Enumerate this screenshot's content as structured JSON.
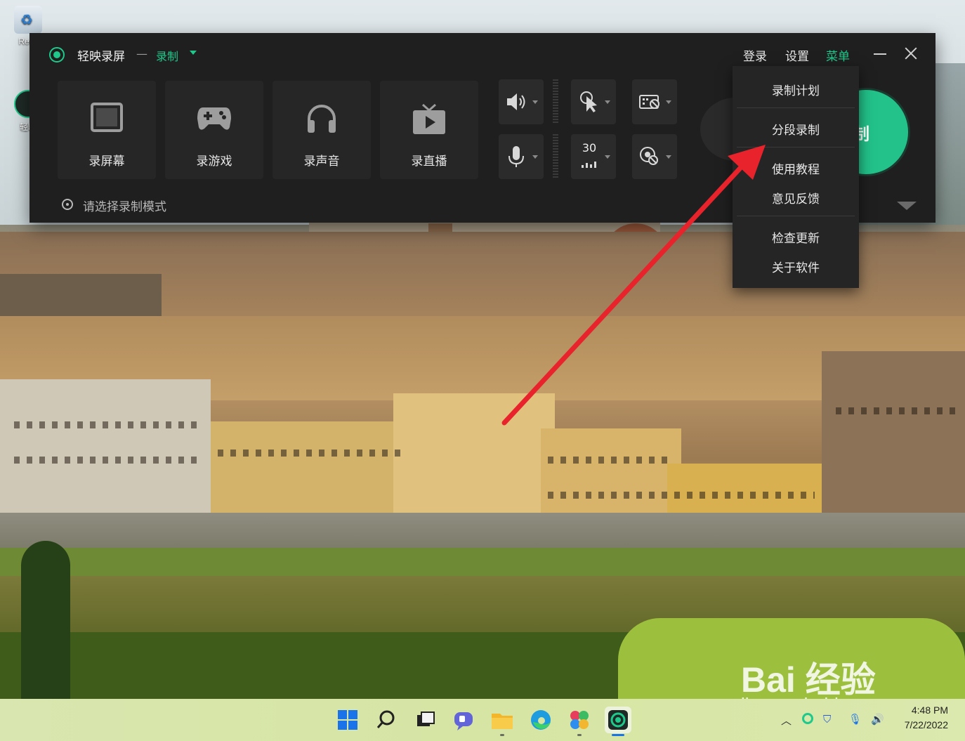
{
  "desktop": {
    "icons": [
      {
        "label": "Recy",
        "icon": "recycle-bin-icon"
      },
      {
        "label": "轻映",
        "icon": "app-shortcut-icon"
      }
    ],
    "watermark": {
      "brand": "Bai 经验",
      "url": "jingyan.baidu.com"
    }
  },
  "app": {
    "title": "轻映录屏",
    "separator": "—",
    "mode": "录制",
    "top_links": {
      "login": "登录",
      "settings": "设置",
      "menu": "菜单"
    },
    "modes": [
      {
        "label": "录屏幕",
        "icon": "monitor-icon"
      },
      {
        "label": "录游戏",
        "icon": "gamepad-icon"
      },
      {
        "label": "录声音",
        "icon": "headphones-icon"
      },
      {
        "label": "录直播",
        "icon": "tv-play-icon"
      }
    ],
    "controls": {
      "speaker": "speaker-icon",
      "microphone": "microphone-icon",
      "cursor": "cursor-icon",
      "fps": "30",
      "keyboard": "keyboard-off-icon",
      "webcam": "webcam-off-icon"
    },
    "hint": "请选择录制模式",
    "record_button": "录制",
    "accent": "#1ec98b"
  },
  "menu": {
    "items": [
      "录制计划",
      "分段录制",
      "使用教程",
      "意见反馈",
      "检查更新",
      "关于软件"
    ]
  },
  "annotation": {
    "arrow_color": "#e8232b"
  },
  "taskbar": {
    "apps": [
      "windows-start-icon",
      "search-icon",
      "task-view-icon",
      "chat-icon",
      "file-explorer-icon",
      "edge-browser-icon",
      "photos-icon",
      "recorder-app-icon"
    ],
    "time": "4:48 PM",
    "date": "7/22/2022"
  }
}
